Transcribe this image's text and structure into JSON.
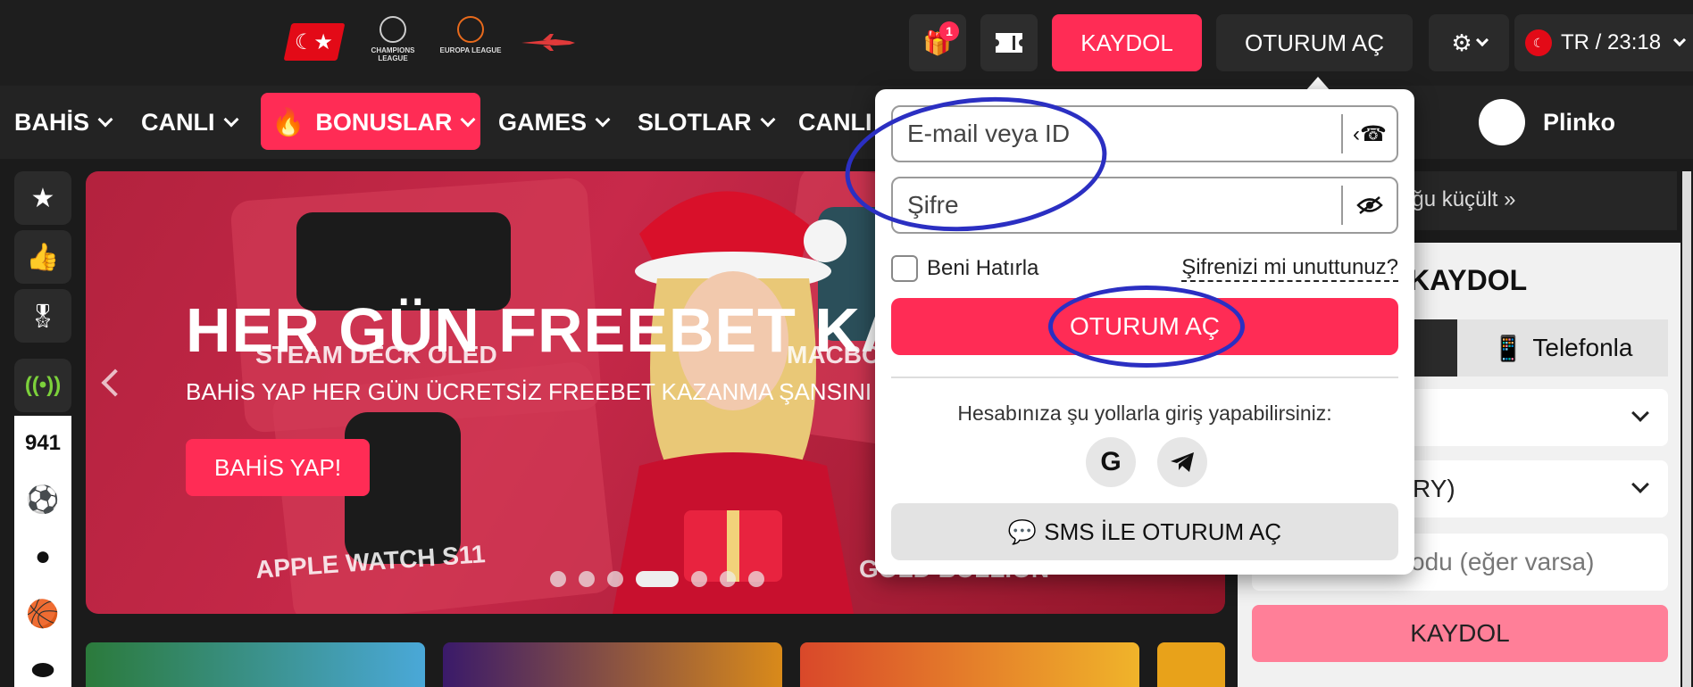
{
  "topbar": {
    "gift_badge": "1",
    "register_label": "KAYDOL",
    "login_label": "OTURUM AÇ",
    "lang_time": "TR / 23:18",
    "league_ucl": "CHAMPIONS LEAGUE",
    "league_uel": "EUROPA LEAGUE"
  },
  "nav": {
    "items": [
      "BAHİS",
      "CANLI",
      "BONUSLAR",
      "GAMES",
      "SLOTLAR",
      "CANLI"
    ],
    "plinko": "Plinko"
  },
  "sidebar": {
    "count": "941"
  },
  "banner": {
    "title": "HER GÜN FREEBET KAZA",
    "subtitle": "BAHİS YAP HER GÜN ÜCRETSİZ FREEBET KAZANMA ŞANSINI",
    "cta": "BAHİS YAP!",
    "overlay_1": "STEAM DECK OLED",
    "overlay_2": "MACBO",
    "overlay_3": "APPLE WATCH S11",
    "overlay_4": "GOLD BULLION"
  },
  "side": {
    "collapse_text": "oğu küçült »",
    "register_title": "KAYDOL",
    "tab_phone": "Telefonla",
    "currency_partial": "RY)",
    "promo_partial": "odu (eğer varsa)",
    "submit": "KAYDOL"
  },
  "login_popup": {
    "email_placeholder": "E-mail veya ID",
    "password_placeholder": "Şifre",
    "remember_label": "Beni Hatırla",
    "forgot_label": "Şifrenizi mi unuttunuz?",
    "login_button": "OTURUM AÇ",
    "social_text": "Hesabınıza şu yollarla giriş yapabilirsiniz:",
    "sms_button": "SMS İLE OTURUM AÇ"
  },
  "colors": {
    "accent": "#ff2c55",
    "annotation": "#2b2fc2"
  },
  "icons": [
    "gift-icon",
    "ticket-icon",
    "gear-icon",
    "phone-icon",
    "eye-off-icon",
    "google-icon",
    "telegram-icon",
    "chat-icon",
    "star-icon",
    "thumbs-up-icon",
    "award-icon",
    "live-icon",
    "football-icon",
    "tennis-icon",
    "basketball-icon",
    "hockey-icon",
    "fire-icon"
  ]
}
